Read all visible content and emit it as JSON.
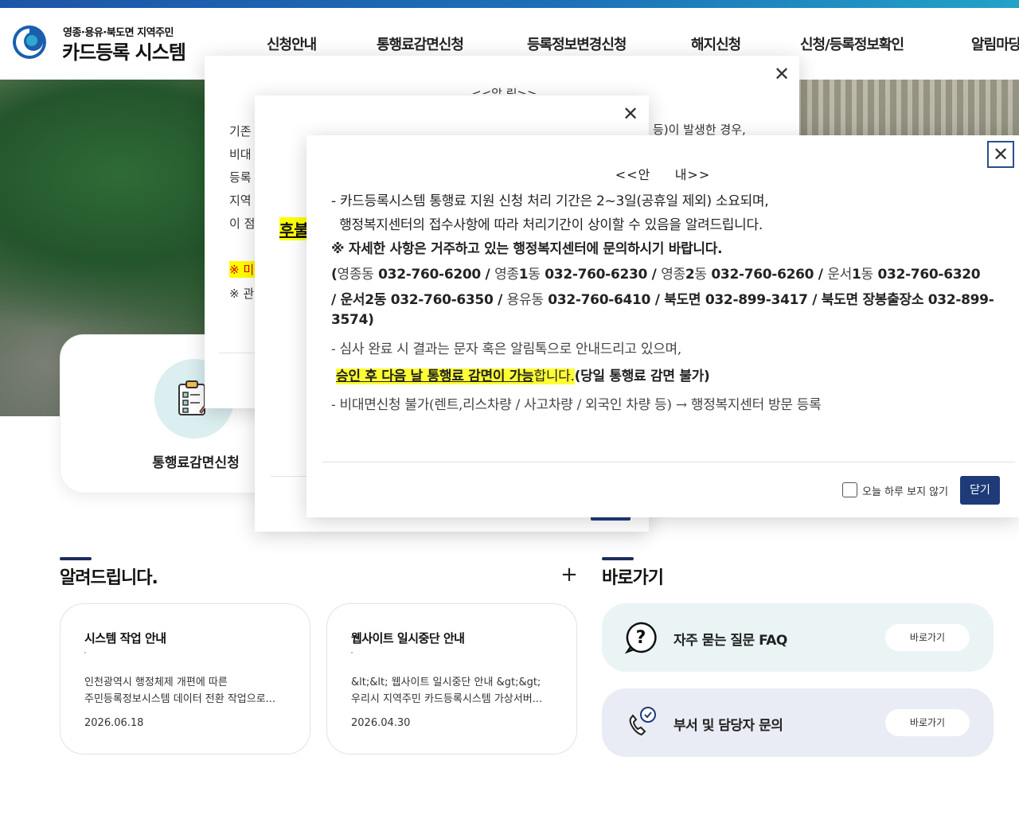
{
  "header": {
    "logo_sub": "영종·용유·북도면 지역주민",
    "logo_main": "카드등록 시스템",
    "nav": [
      "신청안내",
      "통행료감면신청",
      "등록정보변경신청",
      "해지신청",
      "신청/등록정보확인",
      "알림마당"
    ]
  },
  "quick": {
    "label": "통행료감면신청"
  },
  "notices": {
    "title": "알려드립니다.",
    "more": "+",
    "items": [
      {
        "title": "시스템 작업 안내",
        "line1": "인천광역시 행정체제 개편에 따른",
        "line2": "주민등록정보시스템 데이터 전환 작업으로...",
        "date": "2026.06.18"
      },
      {
        "title": "웹사이트 일시중단 안내",
        "line1": "&lt;&lt; 웹사이트 일시중단 안내 &gt;&gt;",
        "line2": "우리시 지역주민 카드등록시스템 가상서버...",
        "date": "2026.04.30"
      }
    ]
  },
  "shortcuts": {
    "title": "바로가기",
    "items": [
      {
        "label": "자주 묻는 질문 FAQ",
        "button": "바로가기",
        "bg": "#eaf4f5",
        "icon": "question-icon"
      },
      {
        "label": "부서 및 담당자 문의",
        "button": "바로가기",
        "bg": "#e9ecf4",
        "icon": "phone-icon"
      }
    ]
  },
  "popup1": {
    "close": "✕",
    "heading": "<<알 림>>",
    "lines": [
      "기존",
      "비대",
      "등록",
      "지역",
      "이 점"
    ],
    "right_fragment": "등)이 발생한 경우,",
    "red_line": "※ 미",
    "note_line": "※ 관"
  },
  "popup2": {
    "close": "✕",
    "highlight": "후불"
  },
  "popup3": {
    "close": "✕",
    "heading": "<<안     내>>",
    "line1": "- 카드등록시스템 통행료 지원 신청 처리 기간은 2~3일(공휴일 제외) 소요되며,",
    "line2": "  행정복지센터의 접수사항에 따라 처리기간이 상이할 수 있음을 알려드립니다.",
    "line3": "※ 자세한 사항은 거주하고 있는 행정복지센터에 문의하시기 바랍니다.",
    "contacts1": {
      "open": "(",
      "a_name": "영종동",
      "a_num": " 032-760-6200 / ",
      "b_name": "영종",
      "b_bold": "1",
      "b_suffix": "동",
      "b_num": " 032-760-6230 / ",
      "c_name": "영종",
      "c_bold": "2",
      "c_suffix": "동",
      "c_num": " 032-760-6260 / ",
      "d_name": "운서",
      "d_bold": "1",
      "d_suffix": "동",
      "d_num": " 032-760-6320"
    },
    "contacts2": {
      "a": "/ 운서2동 032-760-6350 / ",
      "b_name": "용유동",
      "b_rest": " 032-760-6410 / 북도면 032-899-3417 / 북도면 장봉출장소 032-899-"
    },
    "contacts3": "3574)",
    "result_line": "- 심사 완료 시 결과는 문자 혹은 알림톡으로 안내드리고 있으며,",
    "approval_hl": "승인 후 다음 날 통행료 감면이 가능",
    "approval_mid": "합니다.",
    "approval_end": "(당일 통행료 감면 불가)",
    "nonface_line": "- 비대면신청 불가(렌트,리스차량 / 사고차량 / 외국인 차량 등) → 행정복지센터 방문 등록",
    "checkbox_label": "오늘 하루 보지 않기",
    "close_button": "닫기"
  }
}
